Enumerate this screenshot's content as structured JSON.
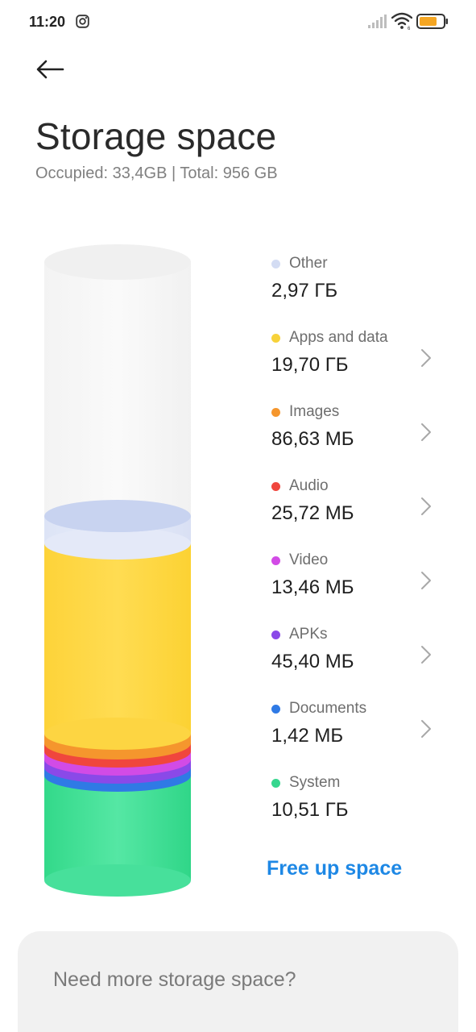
{
  "status_bar": {
    "time": "11:20"
  },
  "header": {
    "title": "Storage space",
    "subtitle": "Occupied: 33,4GB | Total: 956 GB"
  },
  "legend": {
    "items": [
      {
        "label": "Other",
        "value": "2,97 ГБ",
        "color": "#d3dcf3",
        "clickable": false
      },
      {
        "label": "Apps and data",
        "value": "19,70 ГБ",
        "color": "#f7d23a",
        "clickable": true
      },
      {
        "label": "Images",
        "value": "86,63 МБ",
        "color": "#f5962d",
        "clickable": true
      },
      {
        "label": "Audio",
        "value": "25,72 МБ",
        "color": "#f0463d",
        "clickable": true
      },
      {
        "label": "Video",
        "value": "13,46 МБ",
        "color": "#d24be6",
        "clickable": true
      },
      {
        "label": "APKs",
        "value": "45,40 МБ",
        "color": "#8a49e8",
        "clickable": true
      },
      {
        "label": "Documents",
        "value": "1,42 МБ",
        "color": "#2f7ae5",
        "clickable": true
      },
      {
        "label": "System",
        "value": "10,51 ГБ",
        "color": "#36d68e",
        "clickable": false
      }
    ]
  },
  "actions": {
    "free_up_label": "Free up space"
  },
  "more_card": {
    "title": "Need more storage space?"
  },
  "icons": [
    "instagram-icon",
    "signal-icon",
    "wifi-icon",
    "battery-icon",
    "back-arrow-icon",
    "chevron-right-icon"
  ]
}
